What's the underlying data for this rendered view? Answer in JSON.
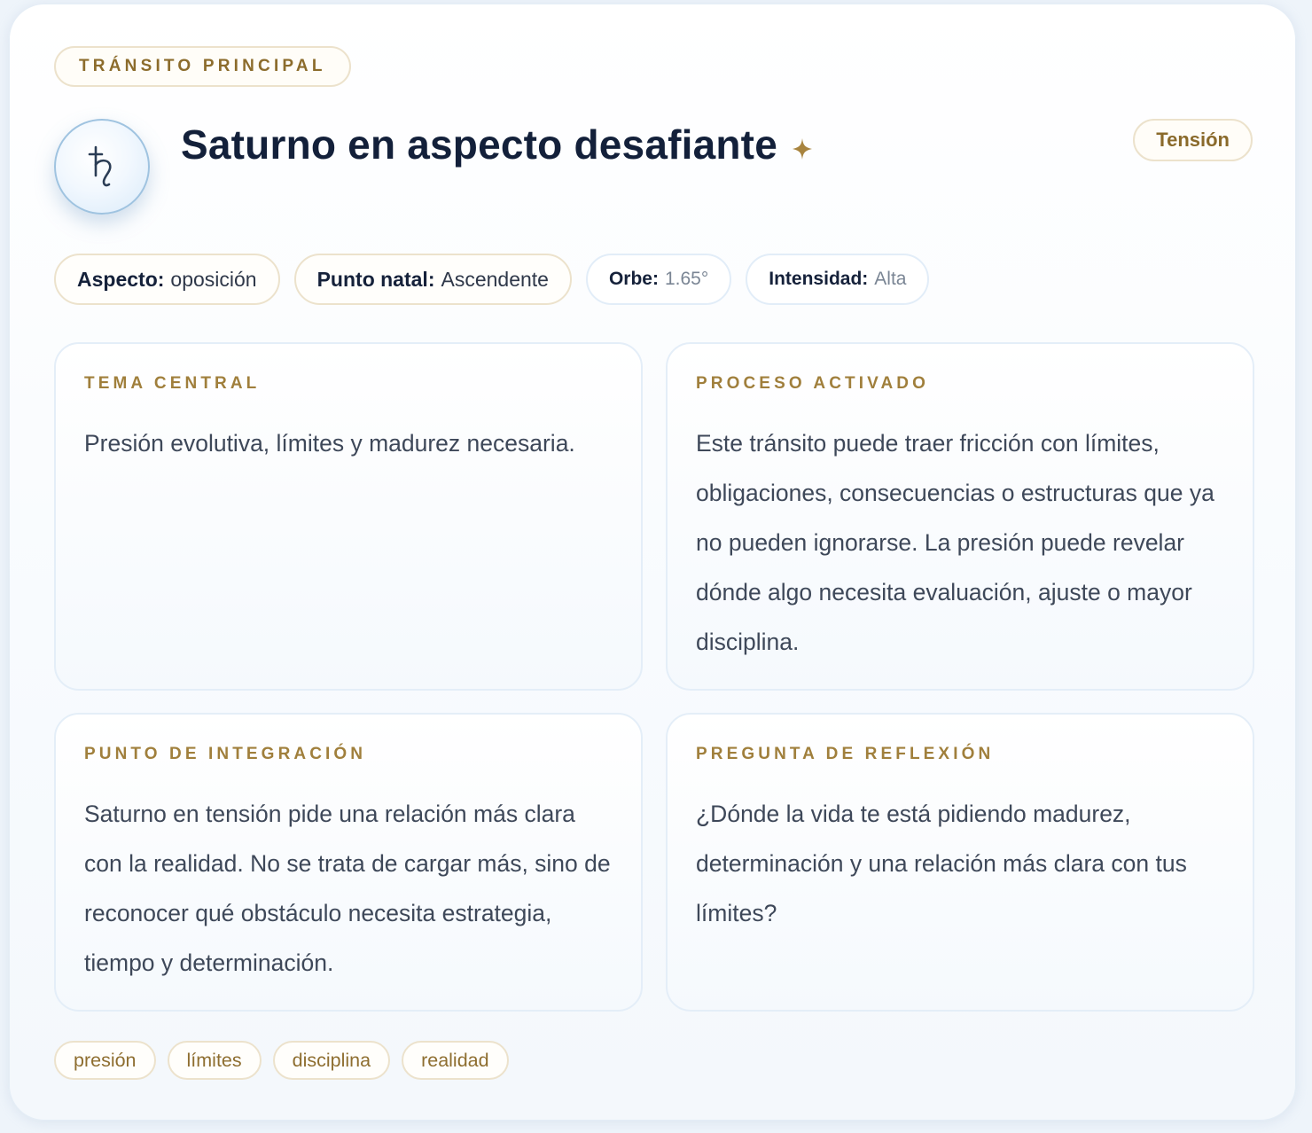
{
  "eyebrow": "TRÁNSITO PRINCIPAL",
  "planet": {
    "icon": "saturn-glyph-icon"
  },
  "title": "Saturno en aspecto desafiante",
  "badge": "Tensión",
  "meta": [
    {
      "key": "Aspecto:",
      "value": "oposición"
    },
    {
      "key": "Punto natal:",
      "value": "Ascendente"
    },
    {
      "key": "Orbe:",
      "value": "1.65°"
    },
    {
      "key": "Intensidad:",
      "value": "Alta"
    }
  ],
  "sections": [
    {
      "label": "TEMA CENTRAL",
      "text": "Presión evolutiva, límites y madurez necesaria."
    },
    {
      "label": "PROCESO ACTIVADO",
      "text": "Este tránsito puede traer fricción con límites, obligaciones, consecuencias o estructuras que ya no pueden ignorarse. La presión puede revelar dónde algo necesita evaluación, ajuste o mayor disciplina."
    },
    {
      "label": "PUNTO DE INTEGRACIÓN",
      "text": "Saturno en tensión pide una relación más clara con la realidad. No se trata de cargar más, sino de reconocer qué obstáculo necesita estrategia, tiempo y determinación."
    },
    {
      "label": "PREGUNTA DE REFLEXIÓN",
      "text": "¿Dónde la vida te está pidiendo madurez, determinación y una relación más clara con tus límites?"
    }
  ],
  "tags": [
    "presión",
    "límites",
    "disciplina",
    "realidad"
  ],
  "colors": {
    "gold_accent": "#a07f3c",
    "title_navy": "#13203a",
    "body_text": "#3e4859",
    "pill_gold_border": "#ece2cc",
    "panel_blue_border": "#e4eef8"
  }
}
